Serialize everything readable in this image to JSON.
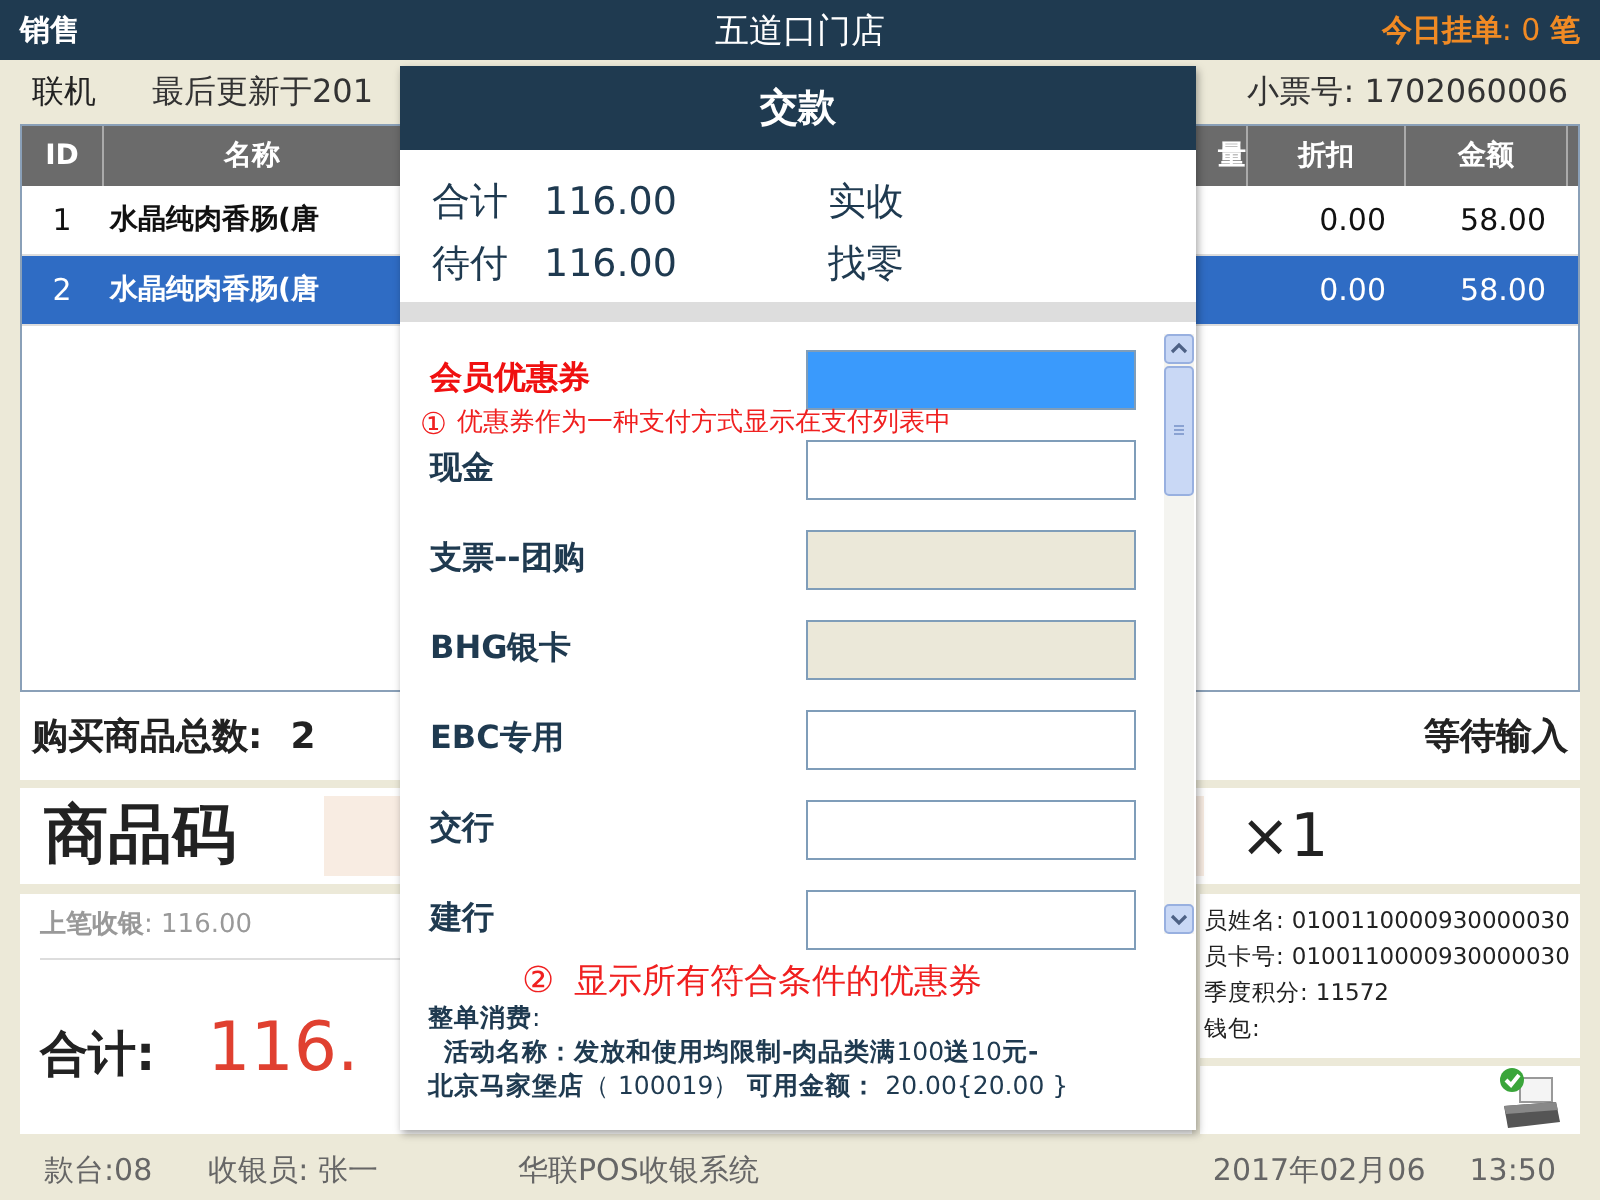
{
  "header": {
    "mode": "销售",
    "store": "五道口门店",
    "held_label": "**今日挂单**:",
    "held_count": "0",
    "held_unit": "笔"
  },
  "status_row": {
    "connection": "联机",
    "last_update": "最后更新于201",
    "ticket_label": "小票号:",
    "ticket_no": "1702060006"
  },
  "table": {
    "columns": [
      "ID",
      "名称",
      "量",
      "折扣",
      "金额"
    ],
    "rows": [
      {
        "id": "1",
        "name": "水晶纯肉香肠(唐",
        "discount": "0.00",
        "amount": "58.00",
        "selected": false
      },
      {
        "id": "2",
        "name": "水晶纯肉香肠(唐",
        "discount": "0.00",
        "amount": "58.00",
        "selected": true
      }
    ]
  },
  "summary": {
    "count_label": "购买商品总数:",
    "count": "2",
    "status": "等待输入"
  },
  "barcode": {
    "label": "商品码",
    "quantity": "×1"
  },
  "info": {
    "last_sale_label": "**上笔收银**:",
    "last_sale": "116.00",
    "total_label": "合计:",
    "total": "116.",
    "member": [
      {
        "label": "员姓名:",
        "value": "0100110000930000030"
      },
      {
        "label": "员卡号:",
        "value": "0100110000930000030"
      },
      {
        "label": "季度积分:",
        "value": "11572"
      },
      {
        "label": "钱包:"
      }
    ]
  },
  "footer": {
    "till": "款台:08",
    "cashier": "收银员: 张一",
    "system": "华联POS收银系统",
    "date": "2017年02月06",
    "time": "13:50"
  },
  "payment_dialog": {
    "title": "交款",
    "lines": [
      {
        "label": "合计",
        "value": "116.00",
        "label2": "实收"
      },
      {
        "label": "待付",
        "value": "116.00",
        "label2": "找零"
      }
    ],
    "methods": [
      {
        "name": "会员优惠券",
        "selected": true,
        "disabled": false
      },
      {
        "name": "现金",
        "selected": false,
        "disabled": false
      },
      {
        "name": "支票--团购",
        "selected": false,
        "disabled": true
      },
      {
        "name": "BHG银卡",
        "selected": false,
        "disabled": true
      },
      {
        "name": "EBC专用",
        "selected": false,
        "disabled": false
      },
      {
        "name": "交行",
        "selected": false,
        "disabled": false
      },
      {
        "name": "建行",
        "selected": false,
        "disabled": false
      }
    ],
    "note1": {
      "mark": "①",
      "text": "优惠券作为一种支付方式显示在支付列表中"
    },
    "note2": {
      "mark": "②",
      "text": "显示所有符合条件的优惠券"
    },
    "coupon": {
      "heading": "**整单消费**:",
      "lines": [
        "**活动名称：发放和使用均限制-肉品类满**100**送**10**元-**",
        "**北京马家堡店**（ 100019） **可用金额：** 20.00{20.00 }"
      ]
    }
  }
}
